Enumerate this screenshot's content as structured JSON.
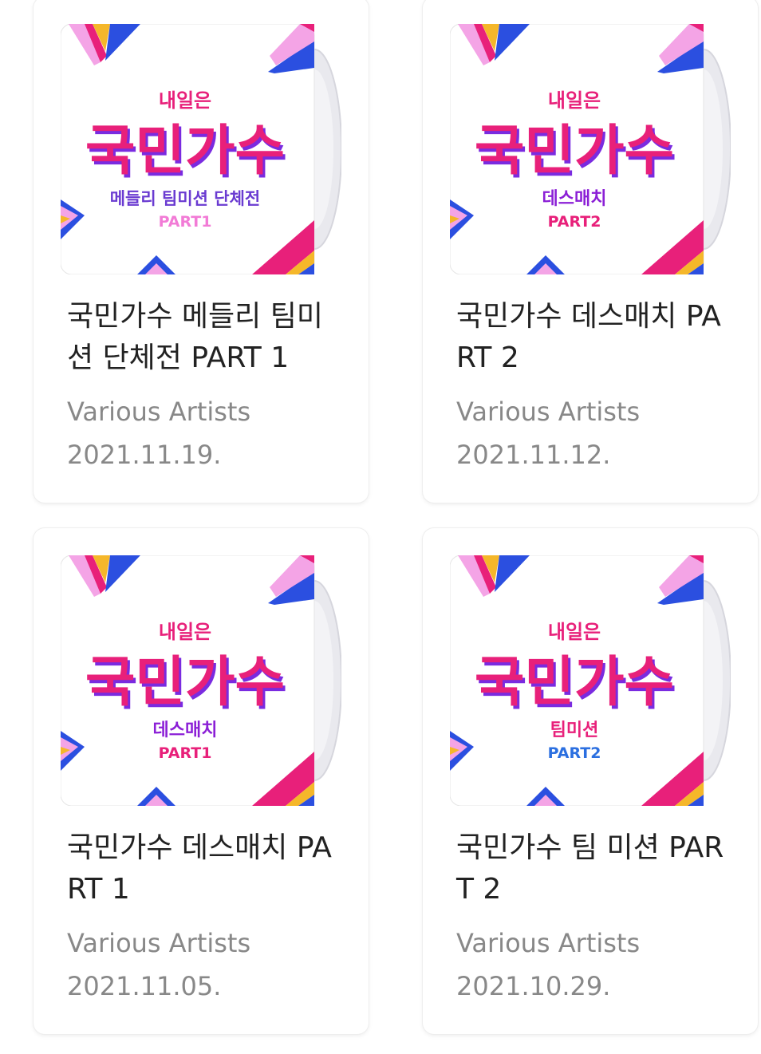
{
  "albums": [
    {
      "title": "국민가수 메들리 팀미션 단체전 PART 1",
      "artist": "Various Artists",
      "date": "2021.11.19.",
      "cover": {
        "top_text": "내일은",
        "main_text": "국민가수",
        "sub_text": "메들리 팀미션 단체전",
        "part_text": "PART1",
        "sub_color": "#6a3bd1",
        "part_color": "#f27bd6"
      }
    },
    {
      "title": "국민가수 데스매치 PART 2",
      "artist": "Various Artists",
      "date": "2021.11.12.",
      "cover": {
        "top_text": "내일은",
        "main_text": "국민가수",
        "sub_text": "데스매치",
        "part_text": "PART2",
        "sub_color": "#8b1fd6",
        "part_color": "#e8207a"
      }
    },
    {
      "title": "국민가수 데스매치 PART 1",
      "artist": "Various Artists",
      "date": "2021.11.05.",
      "cover": {
        "top_text": "내일은",
        "main_text": "국민가수",
        "sub_text": "데스매치",
        "part_text": "PART1",
        "sub_color": "#8b1fd6",
        "part_color": "#e8207a"
      }
    },
    {
      "title": "국민가수 팀 미션 PART 2",
      "artist": "Various Artists",
      "date": "2021.10.29.",
      "cover": {
        "top_text": "내일은",
        "main_text": "국민가수",
        "sub_text": "팀미션",
        "part_text": "PART2",
        "sub_color": "#e8207a",
        "part_color": "#2b6fe0"
      }
    }
  ],
  "colors": {
    "title": "#222222",
    "meta": "#888888",
    "brand_pink": "#e8207a",
    "brand_purple": "#7a2be0",
    "brand_blue": "#2b4fe0",
    "brand_yellow": "#f5b72a"
  }
}
